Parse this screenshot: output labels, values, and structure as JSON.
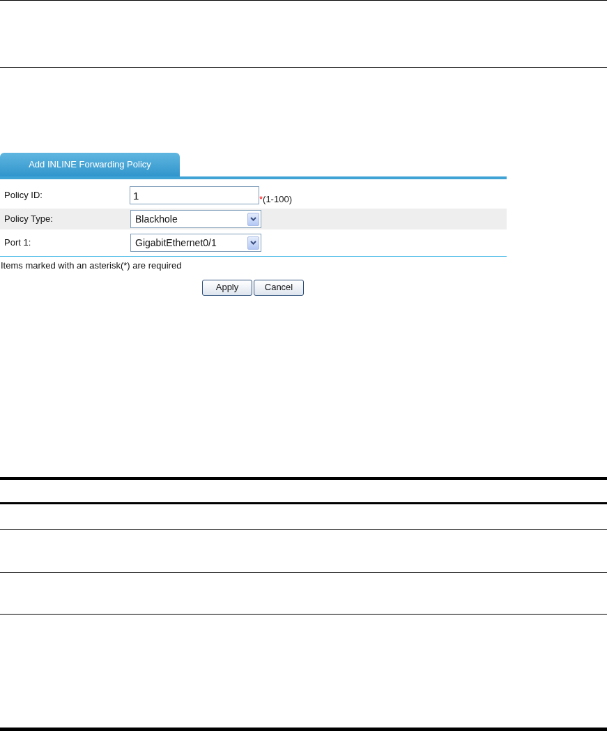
{
  "tab": {
    "label": "Add INLINE Forwarding Policy",
    "selected": true
  },
  "fields": [
    {
      "kind": "input",
      "label": "Policy ID:",
      "value": "1",
      "required_mark": "*",
      "hint": "(1-100)",
      "shaded": false
    },
    {
      "kind": "select",
      "label": "Policy Type:",
      "value": "Blackhole",
      "shaded": true
    },
    {
      "kind": "select",
      "label": "Port 1:",
      "value": "GigabitEthernet0/1",
      "shaded": false
    }
  ],
  "note": "Items marked with an asterisk(*) are required",
  "buttons": [
    "Apply",
    "Cancel"
  ]
}
